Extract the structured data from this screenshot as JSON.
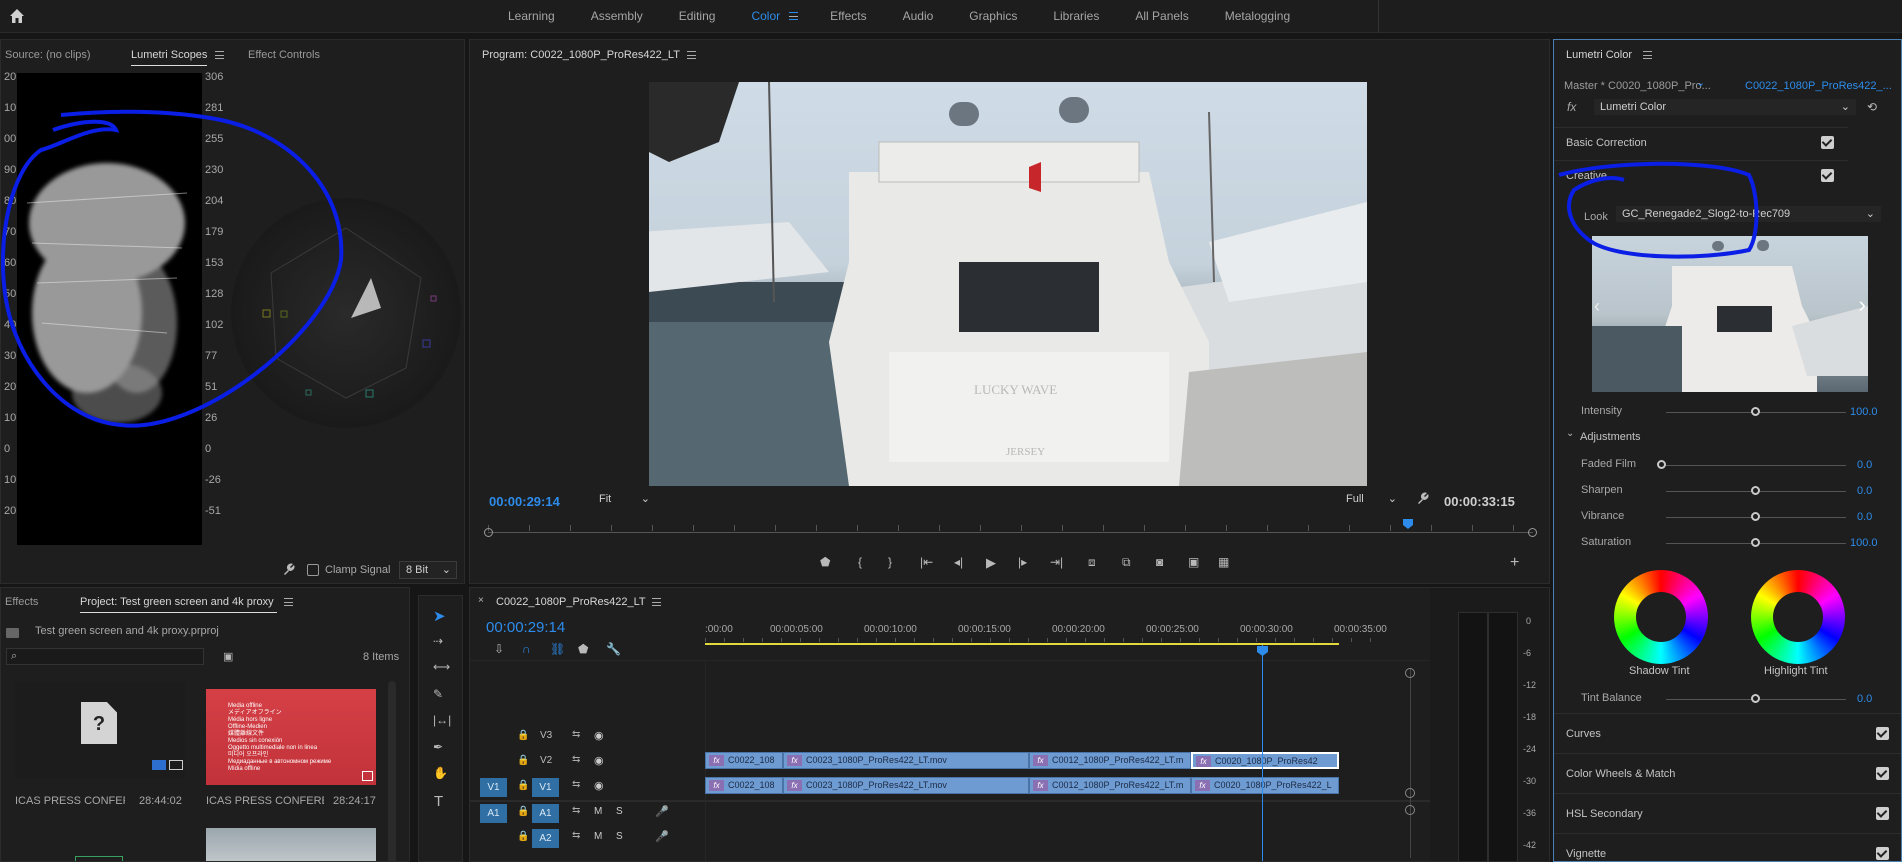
{
  "topbar": {
    "workspaces": [
      "Learning",
      "Assembly",
      "Editing",
      "Color",
      "Effects",
      "Audio",
      "Graphics",
      "Libraries",
      "All Panels",
      "Metalogging"
    ],
    "active": "Color"
  },
  "source_panel": {
    "source_tab": "Source: (no clips)",
    "scopes_tab": "Lumetri Scopes",
    "effect_controls_tab": "Effect Controls",
    "left_ticks": [
      "20",
      "10",
      "00",
      "90",
      "80",
      "70",
      "60",
      "50",
      "40",
      "30",
      "20",
      "10",
      "0",
      "10",
      "20"
    ],
    "right_ticks": [
      "306",
      "281",
      "255",
      "230",
      "204",
      "179",
      "153",
      "128",
      "102",
      "77",
      "51",
      "26",
      "0",
      "-26",
      "-51"
    ],
    "clamp_label": "Clamp Signal",
    "bit_depth": "8 Bit"
  },
  "program": {
    "title": "Program: C0022_1080P_ProRes422_LT",
    "timecode_in": "00:00:29:14",
    "fit": "Fit",
    "resolution": "Full",
    "timecode_out": "00:00:33:15",
    "image_text_1": "LUCKY WAVE",
    "image_text_2": "JERSEY"
  },
  "project": {
    "effects_tab": "Effects",
    "project_tab": "Project: Test green screen and 4k proxy",
    "project_file": "Test green screen and 4k proxy.prproj",
    "items_count": "8 Items",
    "items": [
      {
        "name": "ICAS PRESS CONFERE...",
        "duration": "28:44:02"
      },
      {
        "name": "ICAS PRESS CONFERE...",
        "duration": "28:24:17"
      }
    ],
    "offline_text": [
      "Media offline",
      "メディアオフライン",
      "Média hors ligne",
      "Offline-Medien",
      "媒體離線文件",
      "Medios sin conexión",
      "Oggetto multimediale non in linea",
      "미디어 오프라인",
      "Медиаданные в автономном режиме",
      "Mídia offline"
    ]
  },
  "timeline": {
    "seq_name": "C0022_1080P_ProRes422_LT",
    "timecode": "00:00:29:14",
    "ruler": [
      ":00:00",
      "00:00:05:00",
      "00:00:10:00",
      "00:00:15:00",
      "00:00:20:00",
      "00:00:25:00",
      "00:00:30:00",
      "00:00:35:00"
    ],
    "tracks": [
      {
        "src": "",
        "name": "V3"
      },
      {
        "src": "",
        "name": "V2"
      },
      {
        "src": "V1",
        "name": "V1"
      },
      {
        "src": "A1",
        "name": "A1"
      },
      {
        "src": "",
        "name": "A2"
      }
    ],
    "v2_clips": [
      "C0022_108",
      "C0023_1080P_ProRes422_LT.mov",
      "C0012_1080P_ProRes422_LT.m",
      "C0020_1080P_ProRes42"
    ],
    "v1_clips": [
      "C0022_108",
      "C0023_1080P_ProRes422_LT.mov",
      "C0012_1080P_ProRes422_LT.m",
      "C0020_1080P_ProRes422_L"
    ],
    "meter_ticks": [
      "0",
      "-6",
      "-12",
      "-18",
      "-24",
      "-30",
      "-36",
      "-42"
    ]
  },
  "lumetri": {
    "title": "Lumetri Color",
    "master": "Master * C0020_1080P_Pro...",
    "clip": "C0022_1080P_ProRes422_...",
    "effect": "Lumetri Color",
    "basic": "Basic Correction",
    "creative": "Creative",
    "look_label": "Look",
    "look_value": "GC_Renegade2_Slog2-to-Rec709",
    "intensity_label": "Intensity",
    "intensity_value": "100.0",
    "adjustments": "Adjustments",
    "sliders": [
      {
        "label": "Faded Film",
        "value": "0.0",
        "pos": 0.0
      },
      {
        "label": "Sharpen",
        "value": "0.0",
        "pos": 0.5
      },
      {
        "label": "Vibrance",
        "value": "0.0",
        "pos": 0.5
      },
      {
        "label": "Saturation",
        "value": "100.0",
        "pos": 0.5
      }
    ],
    "shadow_tint": "Shadow Tint",
    "highlight_tint": "Highlight Tint",
    "tint_balance_label": "Tint Balance",
    "tint_balance_value": "0.0",
    "sections": [
      "Curves",
      "Color Wheels & Match",
      "HSL Secondary",
      "Vignette"
    ]
  }
}
